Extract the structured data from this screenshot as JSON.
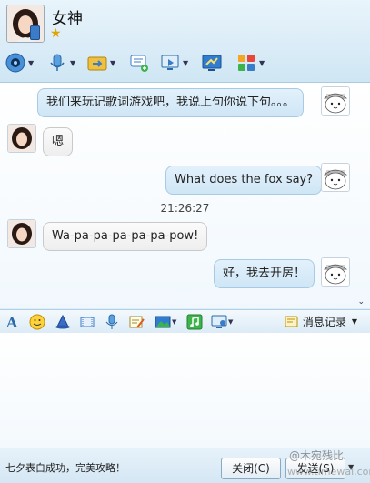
{
  "header": {
    "contact_name": "女神",
    "toolbar_icons": [
      "video-call-icon",
      "voice-call-icon",
      "file-transfer-icon",
      "chat-group-icon",
      "remote-desktop-icon",
      "screen-share-icon",
      "apps-icon"
    ]
  },
  "chat": {
    "messages": [
      {
        "from": "me",
        "text": "我们来玩记歌词游戏吧，我说上句你说下句。。。"
      },
      {
        "from": "them",
        "text": "嗯"
      },
      {
        "from": "me",
        "text": "What does the fox say?"
      },
      {
        "from": "them",
        "text": "Wa-pa-pa-pa-pa-pa-pow!"
      },
      {
        "from": "me",
        "text": "好，我去开房！"
      }
    ],
    "timestamp": "21:26:27"
  },
  "input_toolbar": {
    "icons": [
      "font-icon",
      "emoji-icon",
      "magic-icon",
      "screenshot-icon",
      "voice-message-icon",
      "draw-icon",
      "image-icon",
      "music-icon",
      "screen-capture-icon"
    ],
    "history_label": "消息记录"
  },
  "input": {
    "value": ""
  },
  "footer": {
    "ad_text": "七夕表白成功，完美攻略！",
    "close_label": "关闭(C)",
    "send_label": "发送(S)",
    "watermark": "@木宛残比",
    "watermark2": "www.timewal.com"
  },
  "colors": {
    "accent": "#3a7cc8",
    "my_bubble": "#d8ebf8",
    "their_bubble": "#f2f2f2",
    "header_bg": "#d6eaf6"
  }
}
